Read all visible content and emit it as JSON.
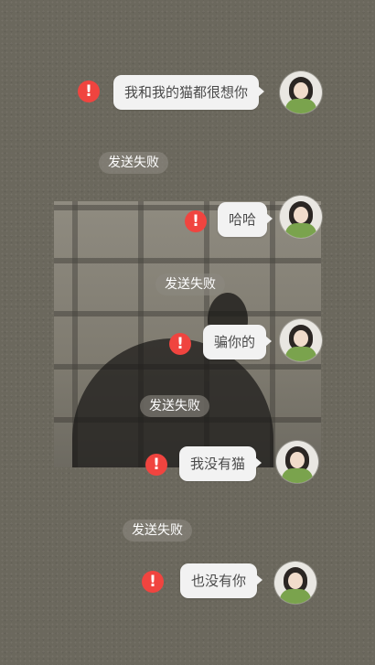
{
  "conversation": {
    "status_failed": "发送失败",
    "messages": [
      {
        "text": "我和我的猫都很想你"
      },
      {
        "text": "哈哈"
      },
      {
        "text": "骗你的"
      },
      {
        "text": "我没有猫"
      },
      {
        "text": "也没有你"
      }
    ],
    "error_glyph": "!",
    "colors": {
      "background": "#6b685d",
      "bubble": "#f2f2f2",
      "bubble_text": "#4a4a4a",
      "error": "#f0443f"
    },
    "icons": [
      "error-icon",
      "avatar"
    ]
  }
}
